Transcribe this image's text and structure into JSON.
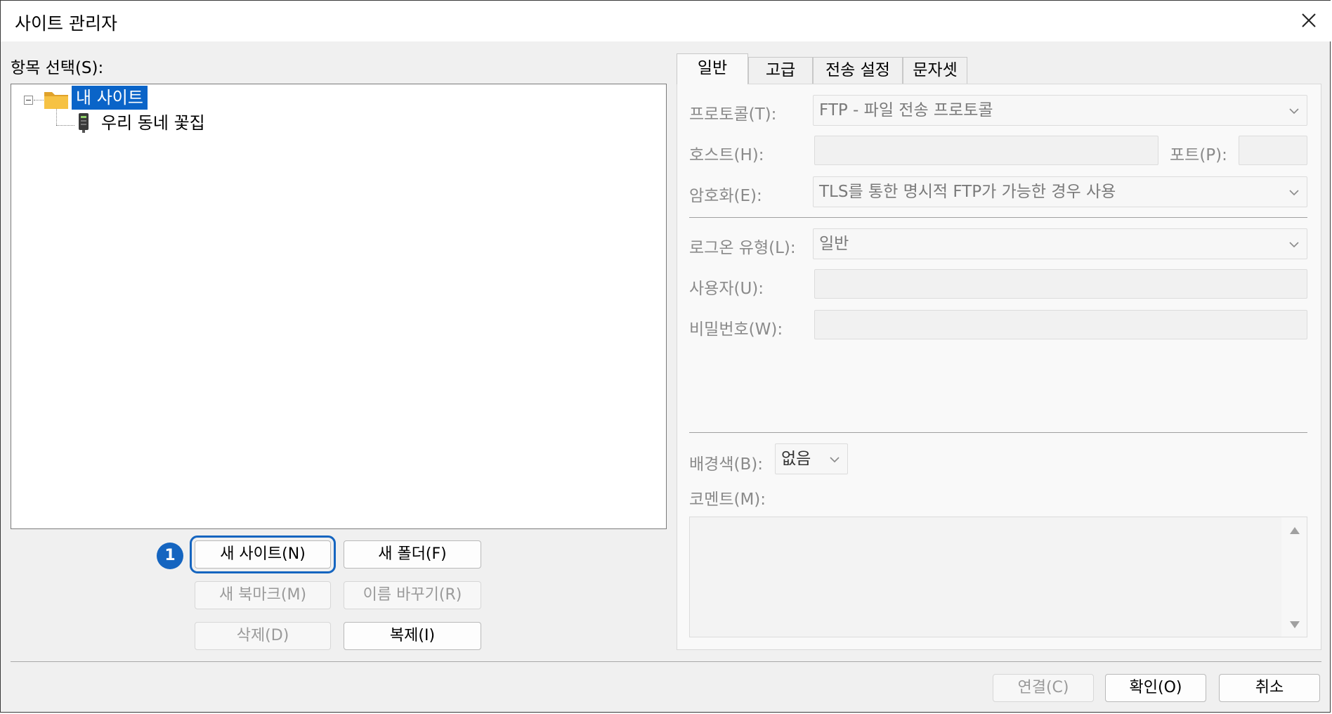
{
  "window": {
    "title": "사이트 관리자"
  },
  "left": {
    "select_label": "항목 선택(S):",
    "tree": {
      "folder": "내 사이트",
      "site": "우리 동네 꽃집"
    },
    "buttons": {
      "new_site": "새 사이트(N)",
      "new_folder": "새 폴더(F)",
      "new_bookmark": "새 북마크(M)",
      "rename": "이름 바꾸기(R)",
      "delete": "삭제(D)",
      "duplicate": "복제(I)"
    },
    "callout": "1"
  },
  "tabs": [
    "일반",
    "고급",
    "전송 설정",
    "문자셋"
  ],
  "general": {
    "protocol_label": "프로토콜(T):",
    "protocol_value": "FTP - 파일 전송 프로토콜",
    "host_label": "호스트(H):",
    "host_value": "",
    "port_label": "포트(P):",
    "port_value": "",
    "encryption_label": "암호화(E):",
    "encryption_value": "TLS를 통한 명시적 FTP가 가능한 경우 사용",
    "logon_label": "로그온 유형(L):",
    "logon_value": "일반",
    "user_label": "사용자(U):",
    "user_value": "",
    "password_label": "비밀번호(W):",
    "password_value": "",
    "bgcolor_label": "배경색(B):",
    "bgcolor_value": "없음",
    "comment_label": "코멘트(M):",
    "comment_value": ""
  },
  "footer": {
    "connect": "연결(C)",
    "ok": "확인(O)",
    "cancel": "취소"
  },
  "colors": {
    "selection": "#0a64c8",
    "callout": "#1565c0",
    "folder": "#f2b83b"
  }
}
